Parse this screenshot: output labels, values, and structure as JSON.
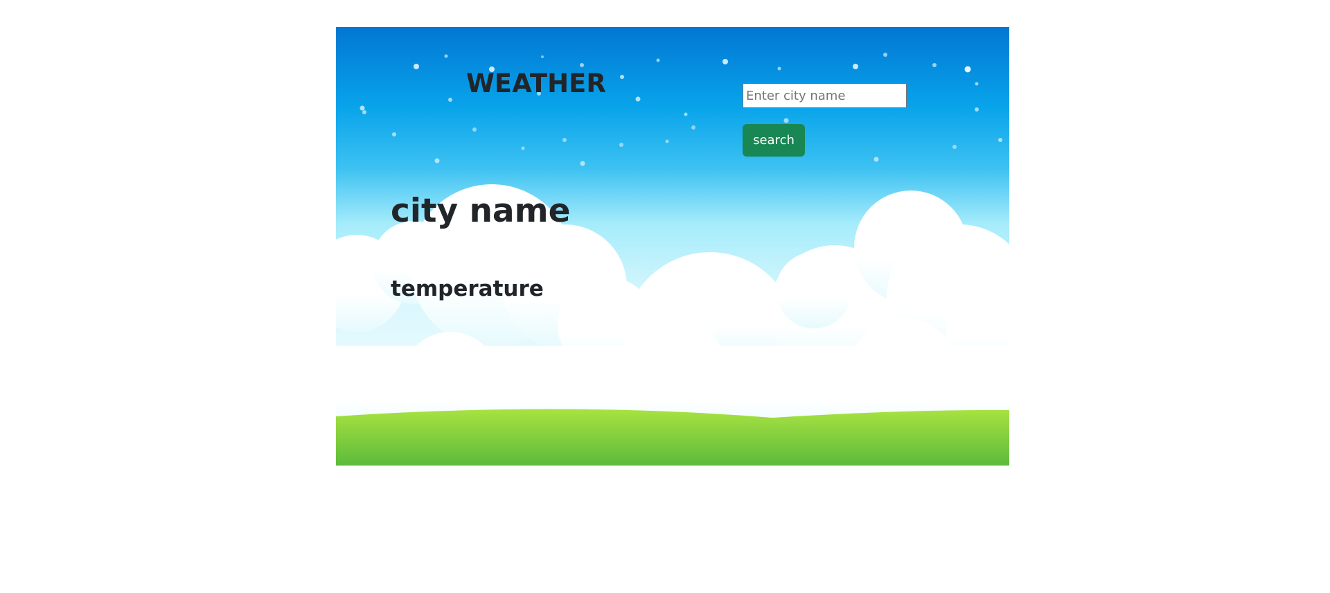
{
  "app": {
    "title": "WEATHER"
  },
  "search": {
    "placeholder": "Enter city name",
    "value": "",
    "button_label": "search"
  },
  "result": {
    "city": "city name",
    "temperature": "temperature"
  },
  "colors": {
    "sky_top": "#0277d3",
    "sky_mid": "#2fb7ef",
    "sky_low": "#aeeefb",
    "cloud": "#ffffff",
    "grass_top": "#a6e03f",
    "grass_bottom": "#5fbd3b",
    "button": "#198754",
    "text": "#212529"
  }
}
